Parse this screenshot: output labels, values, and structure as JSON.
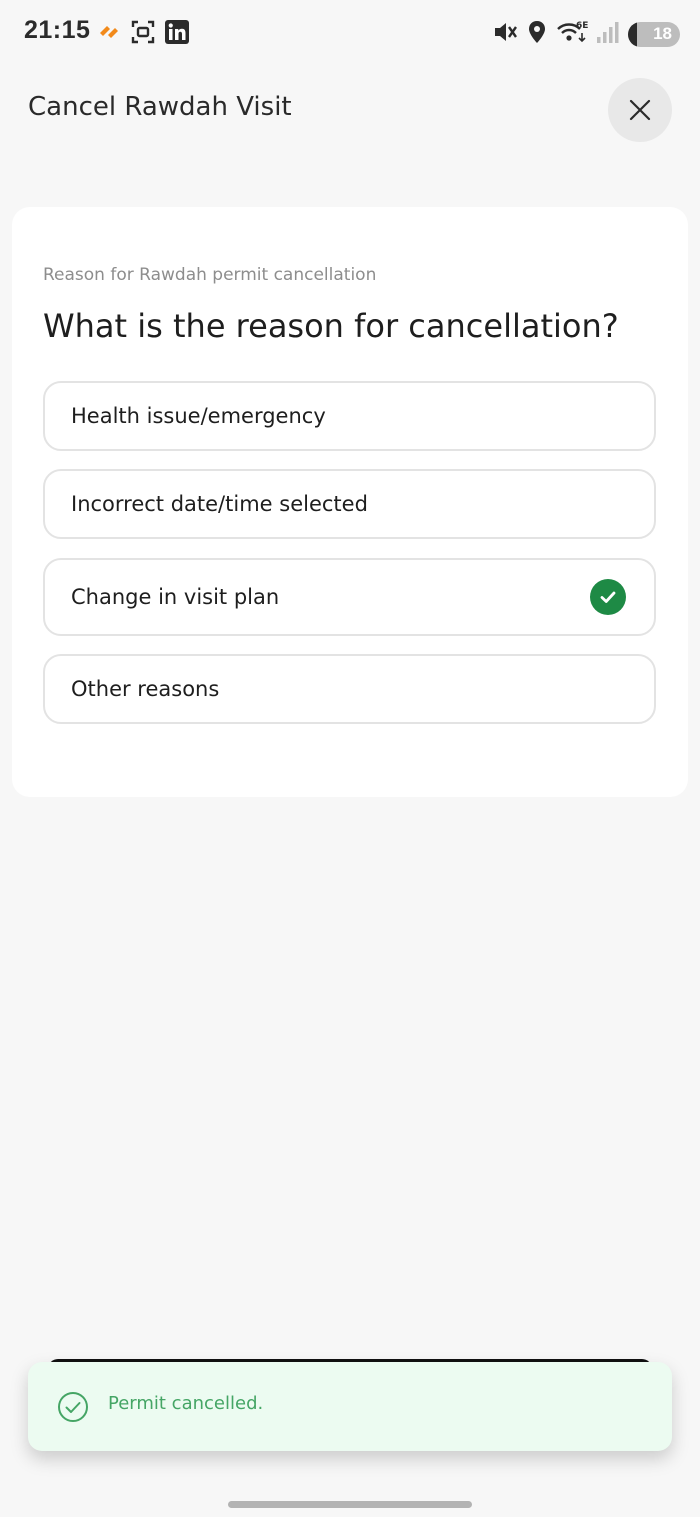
{
  "status_bar": {
    "time": "21:15",
    "battery_level": "18",
    "icons_left": [
      "tray-app-icon",
      "scan-icon",
      "linkedin-icon"
    ],
    "icons_right": [
      "mute-vibrate-icon",
      "location-icon",
      "wifi-6e-icon",
      "signal-icon",
      "battery-icon"
    ]
  },
  "header": {
    "title": "Cancel Rawdah Visit"
  },
  "form": {
    "subtitle": "Reason for Rawdah permit cancellation",
    "question": "What is the reason for cancellation?",
    "options": [
      {
        "label": "Health issue/emergency",
        "selected": false
      },
      {
        "label": "Incorrect date/time selected",
        "selected": false
      },
      {
        "label": "Change in visit plan",
        "selected": true
      },
      {
        "label": "Other reasons",
        "selected": false
      }
    ],
    "selected_color": "#1e8a45"
  },
  "toast": {
    "message": "Permit cancelled.",
    "color": "#45a565",
    "background": "#ecfbf1"
  }
}
